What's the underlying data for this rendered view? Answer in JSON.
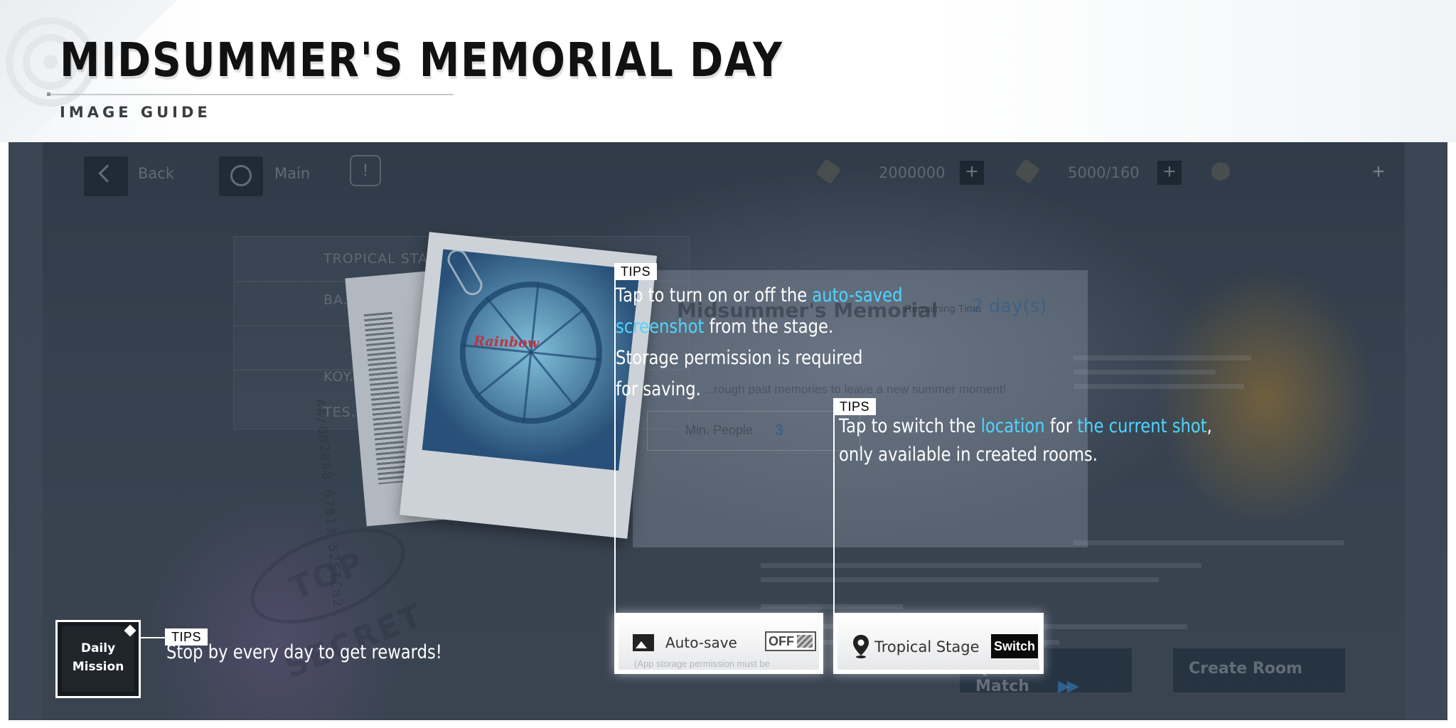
{
  "header": {
    "title": "MIDSUMMER'S MEMORIAL DAY",
    "subtitle": "IMAGE GUIDE"
  },
  "game": {
    "topbar": {
      "back_label": "Back",
      "main_label": "Main",
      "currency1": "2000000",
      "currency2": "5000/160"
    },
    "stage_list": [
      "TROPICAL STAGE",
      "BA...",
      "KOY...",
      "TES..."
    ],
    "event_name": "Midsummer's Memorial",
    "remaining_label": "Remaining Time",
    "remaining_value": "2 day(s)",
    "description": "...rough past memories to leave a new summer moment!",
    "min_people_label": "Min. People",
    "min_people_value": "3",
    "photo_sign": "Rainbow",
    "serial": "AA/002088 67813 52SICa2",
    "stamp": "TOP SECRET",
    "buttons": {
      "quick_match": "Quick Match",
      "quick_match_arrows": "▶▶",
      "create_room": "Create Room"
    }
  },
  "tips": {
    "badge": "TIPS",
    "autosave": {
      "l1_a": "Tap to turn on or off the ",
      "l1_hl": "auto-saved",
      "l2_hl": "screenshot",
      "l2_b": " from the stage.",
      "l3": "Storage permission is required",
      "l4": "for saving."
    },
    "location": {
      "l1_a": "Tap to switch the ",
      "l1_hl1": "location",
      "l1_b": " for ",
      "l1_hl2": "the current shot",
      "l1_c": ",",
      "l2": "only available in created rooms."
    },
    "daily": "Stop by every day to get rewards!"
  },
  "autosave_card": {
    "label": "Auto-save",
    "toggle": "OFF",
    "note": "(App storage permission must be",
    "icon": "image-icon"
  },
  "stage_card": {
    "label": "Tropical Stage",
    "switch": "Switch",
    "icon": "location-pin-icon"
  },
  "daily_mission": {
    "line1": "Daily",
    "line2": "Mission"
  },
  "colors": {
    "highlight": "#4fd5ff",
    "screenshot_bg": "#36424f"
  }
}
